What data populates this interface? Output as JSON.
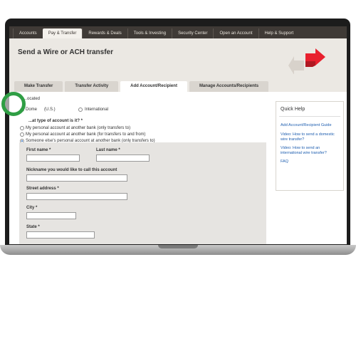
{
  "nav": {
    "tabs": [
      "Accounts",
      "Pay & Transfer",
      "Rewards & Deals",
      "Tools & Investing",
      "Security Center",
      "Open an Account",
      "Help & Support"
    ],
    "active_index": 1
  },
  "header": {
    "title": "Send a Wire or ACH transfer"
  },
  "subtabs": {
    "items": [
      "Make Transfer",
      "Transfer Activity",
      "Add Account/Recipient",
      "Manage Accounts/Recipients"
    ],
    "active_index": 2
  },
  "form": {
    "location_label": "...ocated",
    "domestic_label": "Dome",
    "domestic_suffix": "(U.S.)",
    "international_label": "International",
    "account_type_label": "...at type of account is it? *",
    "account_options": [
      "My personal account at another bank (only transfers to)",
      "My personal account at another bank (for transfers to and from)",
      "Someone else's personal account at another bank (only transfers to)"
    ],
    "selected_account_option": 2,
    "first_name_label": "First name *",
    "last_name_label": "Last name *",
    "nickname_label": "Nickname you would like to call this account",
    "street_label": "Street address *",
    "city_label": "City *",
    "state_label": "State *"
  },
  "quick_help": {
    "title": "Quick Help",
    "links": [
      "Add Account/Recipient Guide",
      "Video: How to send a domestic wire transfer?",
      "Video: How to send an international wire transfer?",
      "FAQ"
    ]
  },
  "colors": {
    "highlight_ring": "#2f9e44",
    "link": "#1f5fb0",
    "logo_red": "#e8202e"
  }
}
